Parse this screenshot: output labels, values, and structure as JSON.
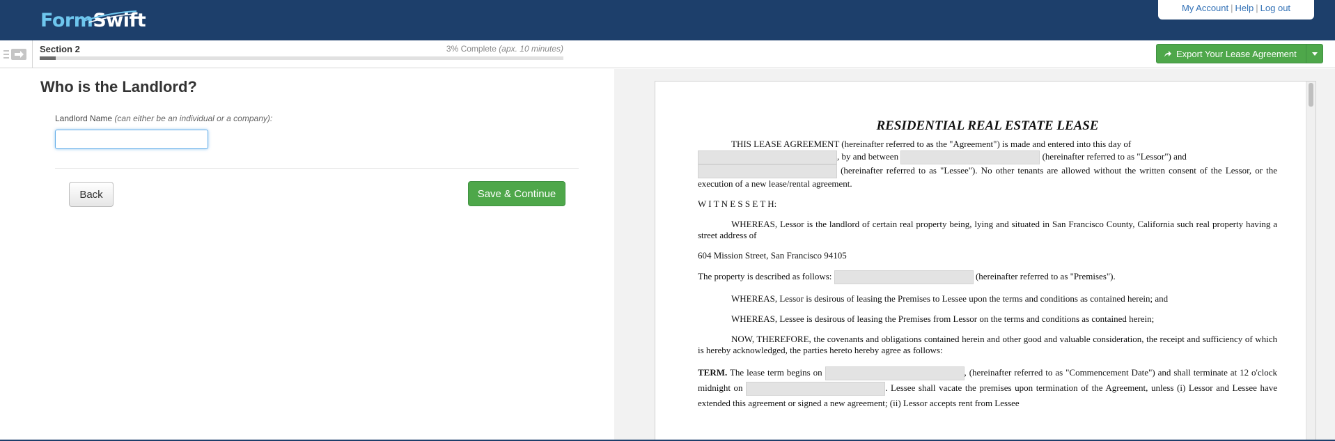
{
  "header": {
    "logo_form": "Form",
    "logo_swift": "Swift",
    "account_links": [
      "My Account",
      "Help",
      "Log out"
    ],
    "account_separator": "|"
  },
  "sectionbar": {
    "section_title": "Section 2",
    "progress_label": "3% Complete",
    "progress_eta": "(apx. 10 minutes)",
    "progress_percent": 3,
    "export_label": "Export Your Lease Agreement",
    "export_icon": "share-arrow-icon",
    "caret_icon": "caret-down-icon"
  },
  "form": {
    "question": "Who is the Landlord?",
    "label_main": "Landlord Name",
    "label_hint": "(can either be an individual or a company):",
    "input_value": "",
    "back_label": "Back",
    "save_label": "Save & Continue"
  },
  "document": {
    "title": "RESIDENTIAL REAL ESTATE LEASE",
    "p1a": "THIS LEASE AGREEMENT (hereinafter referred to as the \"Agreement\") is made and entered into this day of",
    "p1b": ", by and between",
    "p1c": "(hereinafter referred to as \"Lessor\") and",
    "p1d": "(hereinafter referred to as \"Lessee\").  No other tenants are allowed without the written consent of the Lessor, or the execution of a new lease/rental agreement.",
    "witnesseth": "W I T N E S S E T H:",
    "p2": "WHEREAS, Lessor is the landlord of certain real property being, lying and situated in San Francisco County, California such real property having a street address of",
    "address": "604 Mission Street, San Francisco 94105",
    "p3a": "The property is described as follows:",
    "p3b": "(hereinafter referred to as \"Premises\").",
    "p4": "WHEREAS, Lessor is desirous of leasing the Premises to Lessee upon the terms and conditions as contained herein; and",
    "p5": "WHEREAS, Lessee is desirous of leasing the Premises from Lessor on the terms and conditions as contained herein;",
    "p6": "NOW, THEREFORE, the covenants and obligations contained herein and other good and valuable consideration, the receipt and sufficiency of which is hereby acknowledged, the parties hereto hereby agree as follows:",
    "term_label": "TERM.",
    "term_a": "The lease term begins on",
    "term_b": ", (hereinafter referred to as \"Commencement Date\") and shall terminate at 12 o'clock midnight on",
    "term_c": ".  Lessee shall vacate the premises upon termination of the Agreement, unless (i) Lessor and Lessee have extended this agreement or signed a new agreement; (ii) Lessor accepts rent from Lessee"
  },
  "colors": {
    "header_bg": "#1d3f6b",
    "logo_accent": "#6ec6ee",
    "link": "#2f6fb5",
    "button_green": "#4ea74a"
  }
}
